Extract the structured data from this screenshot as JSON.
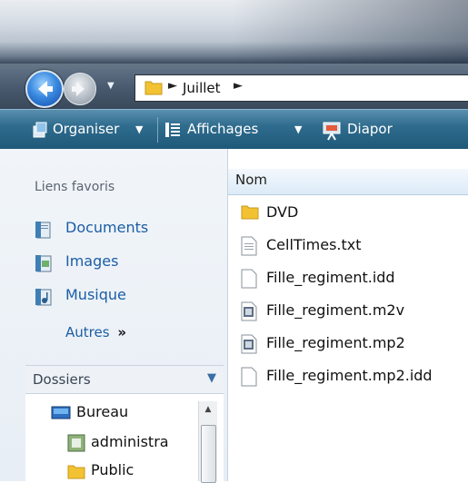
{
  "address": {
    "crumbs": [
      "Juillet"
    ]
  },
  "toolbar": {
    "organise": "Organiser",
    "views": "Affichages",
    "slideshow": "Diapor"
  },
  "nav_pane": {
    "favorites_heading": "Liens favoris",
    "favorites": [
      {
        "label": "Documents",
        "icon": "documents-icon"
      },
      {
        "label": "Images",
        "icon": "images-icon"
      },
      {
        "label": "Musique",
        "icon": "music-icon"
      }
    ],
    "more": "Autres",
    "more_glyph": "»",
    "folders_heading": "Dossiers",
    "tree": [
      {
        "label": "Bureau",
        "icon": "desktop-icon"
      },
      {
        "label": "administra",
        "icon": "user-folder-icon"
      },
      {
        "label": "Public",
        "icon": "folder-icon"
      }
    ]
  },
  "content": {
    "column_name": "Nom",
    "files": [
      {
        "name": "DVD",
        "icon": "folder-icon"
      },
      {
        "name": "CellTimes.txt",
        "icon": "text-file-icon"
      },
      {
        "name": "Fille_regiment.idd",
        "icon": "file-icon"
      },
      {
        "name": "Fille_regiment.m2v",
        "icon": "media-file-icon"
      },
      {
        "name": "Fille_regiment.mp2",
        "icon": "media-file-icon"
      },
      {
        "name": "Fille_regiment.mp2.idd",
        "icon": "file-icon"
      }
    ]
  },
  "colors": {
    "toolbar": "#2f6c8e",
    "link": "#1b5ea6",
    "header_bg": "#dcebf8",
    "folder": "#f2c233"
  }
}
